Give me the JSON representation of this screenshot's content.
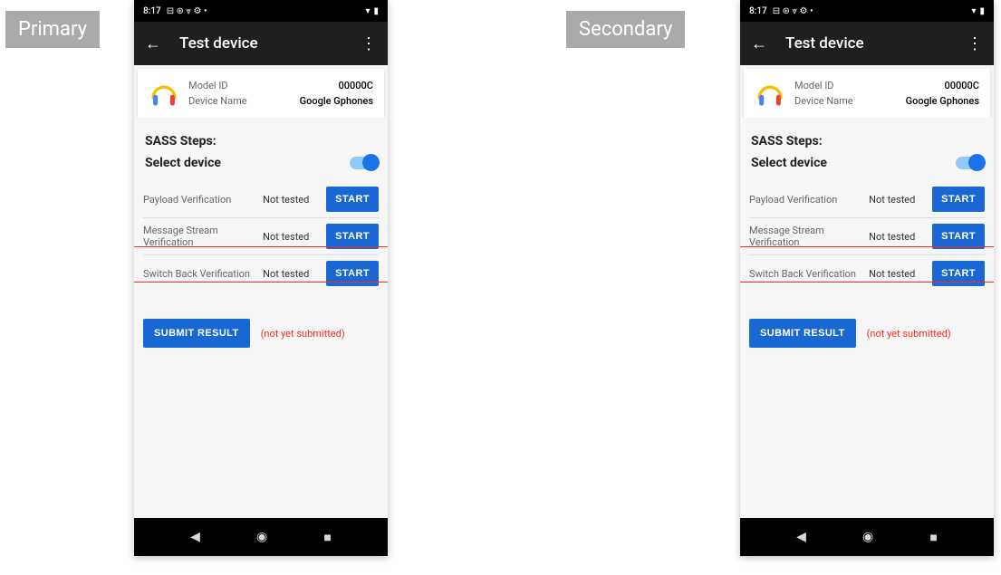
{
  "labels": {
    "primary": "Primary",
    "secondary": "Secondary"
  },
  "status": {
    "time": "8:17",
    "sysicons": "⊟ ⊛ ⩔ ⚙ •"
  },
  "appbar": {
    "title": "Test device"
  },
  "card": {
    "model_label": "Model ID",
    "model_value": "00000C",
    "name_label": "Device Name",
    "name_value": "Google Gphones"
  },
  "body": {
    "sass_title": "SASS Steps:",
    "select_label": "Select device",
    "tests": [
      {
        "name": "Payload Verification",
        "status": "Not tested",
        "action": "START"
      },
      {
        "name": "Message Stream Verification",
        "status": "Not tested",
        "action": "START"
      },
      {
        "name": "Switch Back Verification",
        "status": "Not tested",
        "action": "START"
      }
    ],
    "submit_label": "SUBMIT RESULT",
    "submit_status": "(not yet submitted)"
  }
}
